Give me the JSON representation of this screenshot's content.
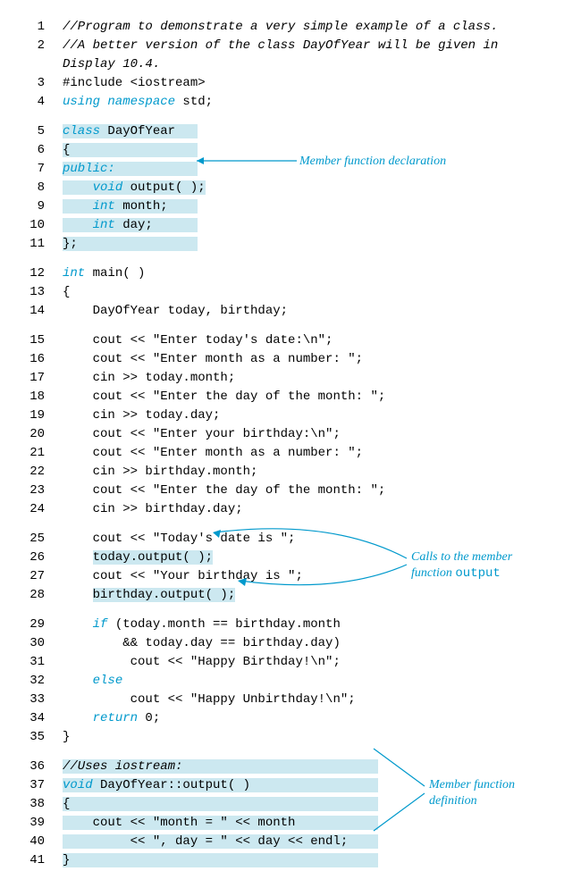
{
  "lines": [
    {
      "n": "1",
      "segs": [
        {
          "t": "//Program to demonstrate a very simple example of a class.",
          "cls": "ital"
        }
      ]
    },
    {
      "n": "2",
      "segs": [
        {
          "t": "//A better version of the class DayOfYear will be given in",
          "cls": "ital"
        }
      ]
    },
    {
      "n": "",
      "segs": [
        {
          "t": "Display 10.4.",
          "cls": "ital"
        }
      ]
    },
    {
      "n": "3",
      "segs": [
        {
          "t": "#include <iostream>",
          "cls": ""
        }
      ]
    },
    {
      "n": "4",
      "segs": [
        {
          "t": "using namespace",
          "cls": "kw"
        },
        {
          "t": " std;",
          "cls": ""
        }
      ]
    },
    {
      "gap": true
    },
    {
      "n": "5",
      "segs": [
        {
          "t": "class",
          "cls": "kw hl"
        },
        {
          "t": " DayOfYear   ",
          "cls": "hl"
        }
      ]
    },
    {
      "n": "6",
      "segs": [
        {
          "t": "{                 ",
          "cls": "hl"
        }
      ]
    },
    {
      "n": "7",
      "segs": [
        {
          "t": "public:           ",
          "cls": "kw hl"
        }
      ]
    },
    {
      "n": "8",
      "segs": [
        {
          "t": "    ",
          "cls": "hl"
        },
        {
          "t": "void",
          "cls": "kw hl"
        },
        {
          "t": " output( );",
          "cls": "hl"
        }
      ]
    },
    {
      "n": "9",
      "segs": [
        {
          "t": "    ",
          "cls": "hl"
        },
        {
          "t": "int",
          "cls": "kw hl"
        },
        {
          "t": " month;    ",
          "cls": "hl"
        }
      ]
    },
    {
      "n": "10",
      "segs": [
        {
          "t": "    ",
          "cls": "hl"
        },
        {
          "t": "int",
          "cls": "kw hl"
        },
        {
          "t": " day;      ",
          "cls": "hl"
        }
      ]
    },
    {
      "n": "11",
      "segs": [
        {
          "t": "};                ",
          "cls": "hl"
        }
      ]
    },
    {
      "gap": true
    },
    {
      "n": "12",
      "segs": [
        {
          "t": "int",
          "cls": "kw"
        },
        {
          "t": " main( )",
          "cls": ""
        }
      ]
    },
    {
      "n": "13",
      "segs": [
        {
          "t": "{",
          "cls": ""
        }
      ]
    },
    {
      "n": "14",
      "segs": [
        {
          "t": "    DayOfYear today, birthday;",
          "cls": ""
        }
      ]
    },
    {
      "gap": true
    },
    {
      "n": "15",
      "segs": [
        {
          "t": "    cout << \"Enter today's date:\\n\";",
          "cls": ""
        }
      ]
    },
    {
      "n": "16",
      "segs": [
        {
          "t": "    cout << \"Enter month as a number: \";",
          "cls": ""
        }
      ]
    },
    {
      "n": "17",
      "segs": [
        {
          "t": "    cin >> today.month;",
          "cls": ""
        }
      ]
    },
    {
      "n": "18",
      "segs": [
        {
          "t": "    cout << \"Enter the day of the month: \";",
          "cls": ""
        }
      ]
    },
    {
      "n": "19",
      "segs": [
        {
          "t": "    cin >> today.day;",
          "cls": ""
        }
      ]
    },
    {
      "n": "20",
      "segs": [
        {
          "t": "    cout << \"Enter your birthday:\\n\";",
          "cls": ""
        }
      ]
    },
    {
      "n": "21",
      "segs": [
        {
          "t": "    cout << \"Enter month as a number: \";",
          "cls": ""
        }
      ]
    },
    {
      "n": "22",
      "segs": [
        {
          "t": "    cin >> birthday.month;",
          "cls": ""
        }
      ]
    },
    {
      "n": "23",
      "segs": [
        {
          "t": "    cout << \"Enter the day of the month: \";",
          "cls": ""
        }
      ]
    },
    {
      "n": "24",
      "segs": [
        {
          "t": "    cin >> birthday.day;",
          "cls": ""
        }
      ]
    },
    {
      "gap": true
    },
    {
      "n": "25",
      "segs": [
        {
          "t": "    cout << \"Today's date is \";",
          "cls": ""
        }
      ]
    },
    {
      "n": "26",
      "segs": [
        {
          "t": "    ",
          "cls": ""
        },
        {
          "t": "today.output( );",
          "cls": "hl"
        }
      ]
    },
    {
      "n": "27",
      "segs": [
        {
          "t": "    cout << \"Your birthday is \";",
          "cls": ""
        }
      ]
    },
    {
      "n": "28",
      "segs": [
        {
          "t": "    ",
          "cls": ""
        },
        {
          "t": "birthday.output( );",
          "cls": "hl"
        }
      ]
    },
    {
      "gap": true
    },
    {
      "n": "29",
      "segs": [
        {
          "t": "    ",
          "cls": ""
        },
        {
          "t": "if",
          "cls": "kw"
        },
        {
          "t": " (today.month == birthday.month",
          "cls": ""
        }
      ]
    },
    {
      "n": "30",
      "segs": [
        {
          "t": "        && today.day == birthday.day)",
          "cls": ""
        }
      ]
    },
    {
      "n": "31",
      "segs": [
        {
          "t": "         cout << \"Happy Birthday!\\n\";",
          "cls": ""
        }
      ]
    },
    {
      "n": "32",
      "segs": [
        {
          "t": "    ",
          "cls": ""
        },
        {
          "t": "else",
          "cls": "kw"
        }
      ]
    },
    {
      "n": "33",
      "segs": [
        {
          "t": "         cout << \"Happy Unbirthday!\\n\";",
          "cls": ""
        }
      ]
    },
    {
      "n": "34",
      "segs": [
        {
          "t": "    ",
          "cls": ""
        },
        {
          "t": "return",
          "cls": "kw"
        },
        {
          "t": " 0;",
          "cls": ""
        }
      ]
    },
    {
      "n": "35",
      "segs": [
        {
          "t": "}",
          "cls": ""
        }
      ]
    },
    {
      "gap": true
    },
    {
      "n": "36",
      "segs": [
        {
          "t": "//Uses iostream:                          ",
          "cls": "ital hl"
        }
      ]
    },
    {
      "n": "37",
      "segs": [
        {
          "t": "void",
          "cls": "kw hl"
        },
        {
          "t": " DayOfYear::output( )                 ",
          "cls": "hl"
        }
      ]
    },
    {
      "n": "38",
      "segs": [
        {
          "t": "{                                         ",
          "cls": "hl"
        }
      ]
    },
    {
      "n": "39",
      "segs": [
        {
          "t": "    cout << \"month = \" << month           ",
          "cls": "hl"
        }
      ]
    },
    {
      "n": "40",
      "segs": [
        {
          "t": "         << \", day = \" << day << endl;    ",
          "cls": "hl"
        }
      ]
    },
    {
      "n": "41",
      "segs": [
        {
          "t": "}                                         ",
          "cls": "hl"
        }
      ]
    }
  ],
  "annotations": {
    "a1": "Member function declaration",
    "a2_l1": "Calls to the member",
    "a2_l2": "function ",
    "a2_l2b": "output",
    "a3_l1": "Member function",
    "a3_l2": "definition"
  }
}
